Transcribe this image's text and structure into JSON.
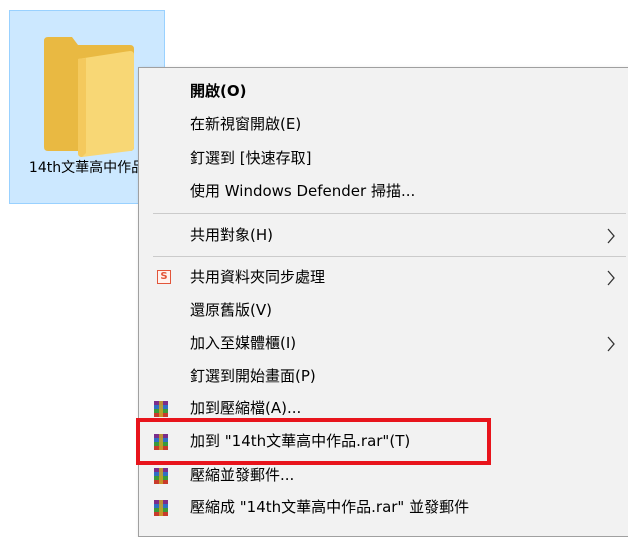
{
  "folder": {
    "name": "14th文華高中作品"
  },
  "menu": {
    "items": [
      {
        "label": "開啟(O)"
      },
      {
        "label": "在新視窗開啟(E)"
      },
      {
        "label": "釘選到 [快速存取]"
      },
      {
        "label": "使用 Windows Defender 掃描..."
      },
      {
        "label": "共用對象(H)"
      },
      {
        "label": "共用資料夾同步處理"
      },
      {
        "label": "還原舊版(V)"
      },
      {
        "label": "加入至媒體櫃(I)"
      },
      {
        "label": "釘選到開始畫面(P)"
      },
      {
        "label": "加到壓縮檔(A)..."
      },
      {
        "label": "加到 \"14th文華高中作品.rar\"(T)"
      },
      {
        "label": "壓縮並發郵件..."
      },
      {
        "label": "壓縮成 \"14th文華高中作品.rar\" 並發郵件"
      }
    ],
    "sync_icon_letter": "S"
  },
  "colors": {
    "selection_bg": "#cce8ff",
    "selection_border": "#99d1ff",
    "menu_bg": "#f2f2f2",
    "highlight": "#e8141c"
  }
}
